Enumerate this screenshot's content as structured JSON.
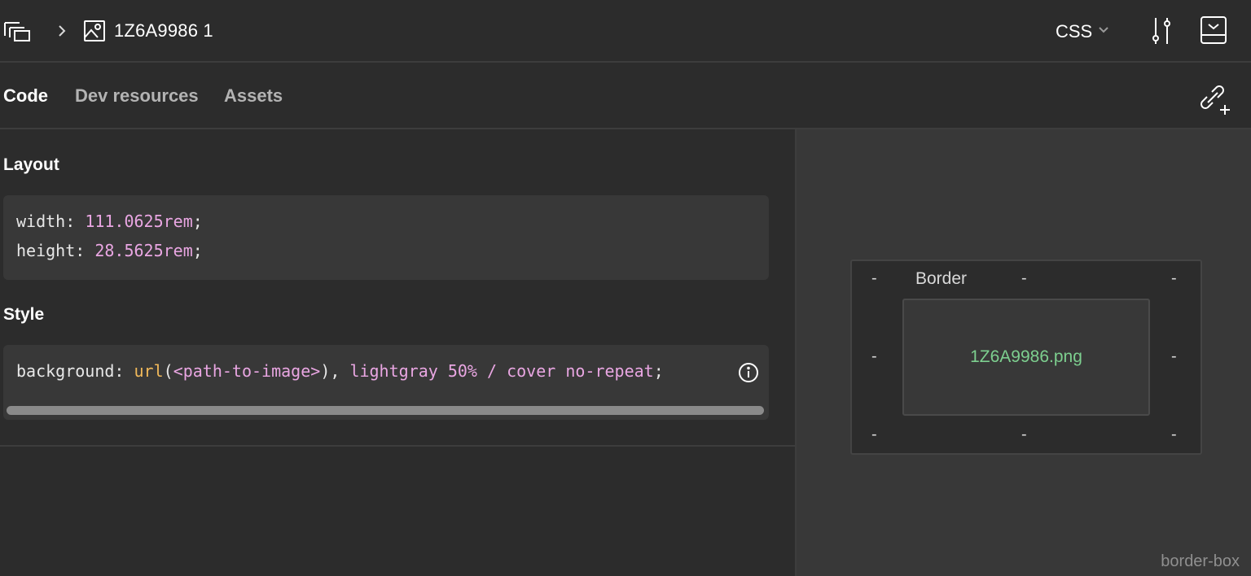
{
  "header": {
    "layer_name": "1Z6A9986 1",
    "language": "CSS"
  },
  "tabs": [
    {
      "label": "Code",
      "active": true
    },
    {
      "label": "Dev resources",
      "active": false
    },
    {
      "label": "Assets",
      "active": false
    }
  ],
  "layout_section": {
    "title": "Layout",
    "lines": [
      {
        "prop": "width",
        "value": "111.0625rem"
      },
      {
        "prop": "height",
        "value": "28.5625rem"
      }
    ]
  },
  "style_section": {
    "title": "Style",
    "prop": "background",
    "fn": "url",
    "arg": "<path-to-image>",
    "rest": "lightgray 50% / cover no-repeat"
  },
  "box_model": {
    "border_label": "Border",
    "placeholder": "-",
    "inner_label": "1Z6A9986.png",
    "box_sizing": "border-box"
  },
  "colors": {
    "background": "#2c2c2c",
    "panel": "#383838",
    "number": "#e9a6e2",
    "function": "#f1b95a",
    "file_name": "#7dcf8f"
  },
  "icons": [
    "frames-icon",
    "chevron-right-icon",
    "image-icon",
    "chevron-down-icon",
    "sliders-icon",
    "panel-toggle-icon",
    "link-plus-icon",
    "info-icon"
  ]
}
